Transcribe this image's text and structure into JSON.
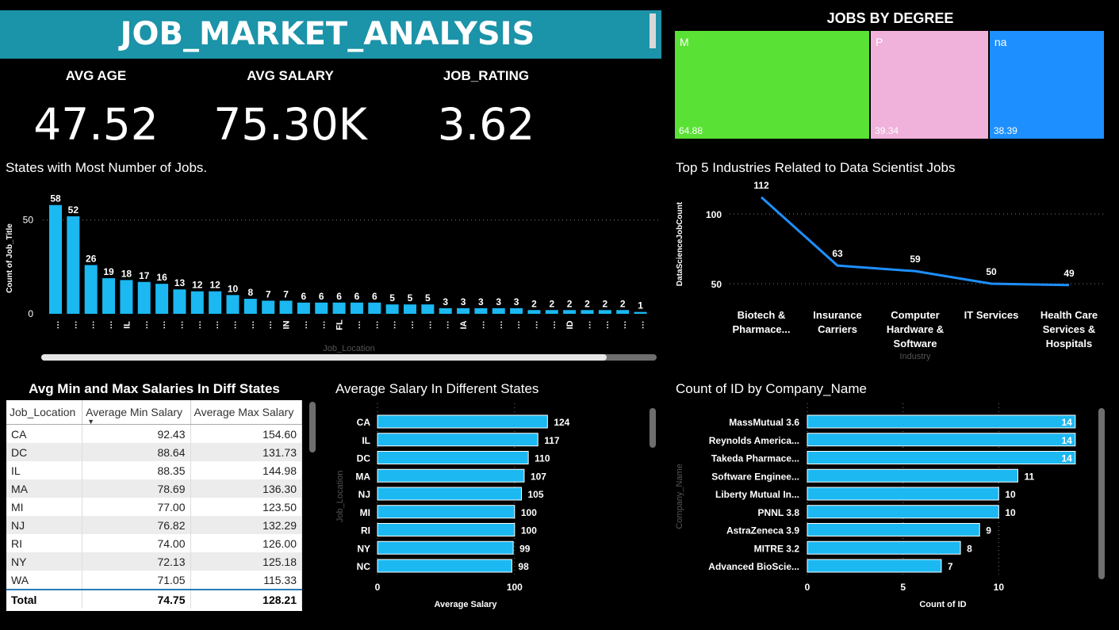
{
  "header": {
    "title": "JOB_MARKET_ANALYSIS"
  },
  "kpis": [
    {
      "label": "AVG AGE",
      "value": "47.52"
    },
    {
      "label": "AVG SALARY",
      "value": "75.30K"
    },
    {
      "label": "JOB_RATING",
      "value": "3.62"
    }
  ],
  "colors": {
    "accent": "#1bb8f2",
    "banner": "#1b93a8",
    "line": "#1e8fff"
  },
  "chart_data": [
    {
      "type": "treemap",
      "title": "JOBS BY DEGREE",
      "categories": [
        "M",
        "P",
        "na"
      ],
      "values": [
        64.88,
        39.34,
        38.39
      ],
      "value_labels": [
        "64.88",
        "39.34",
        "38.39"
      ],
      "colors": [
        "#5ae135",
        "#f0b1da",
        "#1e8fff"
      ]
    },
    {
      "type": "bar",
      "title": "States with Most Number of Jobs.",
      "xlabel": "Job_Location",
      "ylabel": "Count of Job_Title",
      "yticks": [
        "0",
        "50"
      ],
      "ylim": [
        0,
        60
      ],
      "grid": true,
      "values": [
        58,
        52,
        26,
        19,
        18,
        17,
        16,
        13,
        12,
        12,
        10,
        8,
        7,
        7,
        6,
        6,
        6,
        6,
        6,
        5,
        5,
        5,
        3,
        3,
        3,
        3,
        3,
        2,
        2,
        2,
        2,
        2,
        2,
        1
      ],
      "tick_labels": [
        "…",
        "…",
        "…",
        "…",
        "IL",
        "…",
        "…",
        "…",
        "…",
        "…",
        "…",
        "…",
        "…",
        "IN",
        "…",
        "…",
        "FL",
        "…",
        "…",
        "…",
        "…",
        "…",
        "…",
        "IA",
        "…",
        "…",
        "…",
        "…",
        "…",
        "ID",
        "…",
        "…",
        "…",
        "…"
      ]
    },
    {
      "type": "line",
      "title": "Top 5 Industries Related to Data Scientist Jobs",
      "xlabel": "Industry",
      "ylabel": "DataScienceJobCount",
      "yticks": [
        "50",
        "100"
      ],
      "ylim": [
        45,
        117
      ],
      "grid": true,
      "categories": [
        "Biotech & Pharmace...",
        "Insurance Carriers",
        "Computer Hardware & Software",
        "IT Services",
        "Health Care Services & Hospitals"
      ],
      "category_lines": [
        [
          "Biotech &",
          "Pharmace..."
        ],
        [
          "Insurance",
          "Carriers"
        ],
        [
          "Computer",
          "Hardware &",
          "Software"
        ],
        [
          "IT Services"
        ],
        [
          "Health Care",
          "Services &",
          "Hospitals"
        ]
      ],
      "values": [
        112,
        63,
        59,
        50,
        49
      ],
      "value_labels": [
        "112",
        "63",
        "59",
        "50",
        "49"
      ]
    },
    {
      "type": "table",
      "title": "Avg Min and Max Salaries In Diff States",
      "columns": [
        "Job_Location",
        "Average Min Salary",
        "Average Max Salary"
      ],
      "rows": [
        [
          "CA",
          "92.43",
          "154.60"
        ],
        [
          "DC",
          "88.64",
          "131.73"
        ],
        [
          "IL",
          "88.35",
          "144.98"
        ],
        [
          "MA",
          "78.69",
          "136.30"
        ],
        [
          "MI",
          "77.00",
          "123.50"
        ],
        [
          "NJ",
          "76.82",
          "132.29"
        ],
        [
          "RI",
          "74.00",
          "126.00"
        ],
        [
          "NY",
          "72.13",
          "125.18"
        ],
        [
          "WA",
          "71.05",
          "115.33"
        ]
      ],
      "total": [
        "Total",
        "74.75",
        "128.21"
      ]
    },
    {
      "type": "bar",
      "orientation": "horizontal",
      "title": "Average Salary In Different States",
      "xlabel": "Average Salary",
      "ylabel": "Job_Location",
      "xticks": [
        "0",
        "100"
      ],
      "xlim": [
        0,
        140
      ],
      "categories": [
        "CA",
        "IL",
        "DC",
        "MA",
        "NJ",
        "MI",
        "RI",
        "NY",
        "NC"
      ],
      "values": [
        124,
        117,
        110,
        107,
        105,
        100,
        100,
        99,
        98
      ],
      "value_labels": [
        "124",
        "117",
        "110",
        "107",
        "105",
        "100",
        "100",
        "99",
        "98"
      ]
    },
    {
      "type": "bar",
      "orientation": "horizontal",
      "title": "Count of ID by Company_Name",
      "xlabel": "Count of ID",
      "ylabel": "Company_Name",
      "xticks": [
        "0",
        "5",
        "10"
      ],
      "xlim": [
        0,
        15
      ],
      "categories": [
        "MassMutual 3.6",
        "Reynolds America...",
        "Takeda Pharmace...",
        "Software Enginee...",
        "Liberty Mutual In...",
        "PNNL 3.8",
        "AstraZeneca 3.9",
        "MITRE 3.2",
        "Advanced BioScie..."
      ],
      "values": [
        14,
        14,
        14,
        11,
        10,
        10,
        9,
        8,
        7
      ],
      "value_labels": [
        "14",
        "14",
        "14",
        "11",
        "10",
        "10",
        "9",
        "8",
        "7"
      ]
    }
  ]
}
